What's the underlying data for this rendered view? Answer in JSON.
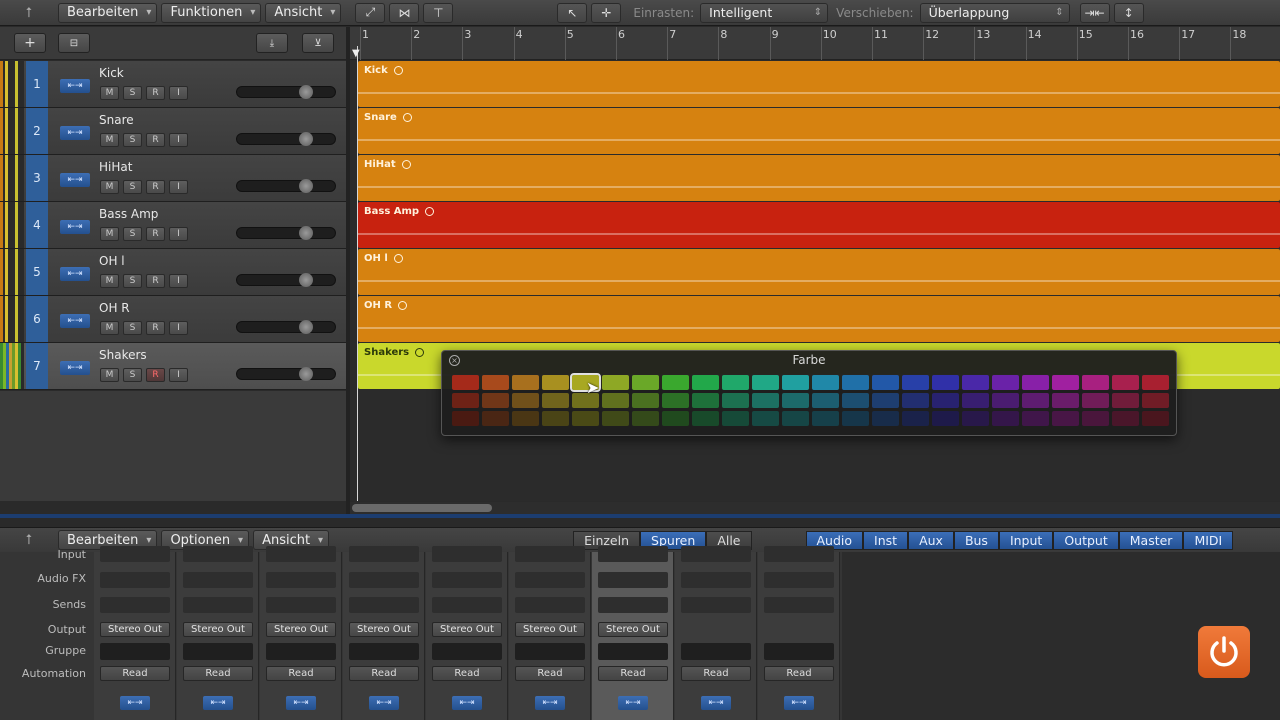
{
  "toolbar": {
    "menus": [
      "Bearbeiten",
      "Funktionen",
      "Ansicht"
    ],
    "snap_label": "Einrasten:",
    "snap_value": "Intelligent",
    "move_label": "Verschieben:",
    "move_value": "Überlappung"
  },
  "ruler": {
    "bars": [
      "1",
      "2",
      "3",
      "4",
      "5",
      "6",
      "7",
      "8",
      "9",
      "10",
      "11",
      "12",
      "13",
      "14",
      "15",
      "16",
      "17",
      "18"
    ]
  },
  "tracks": [
    {
      "num": "1",
      "name": "Kick",
      "color": "#c77a14",
      "region_color": "#d68210"
    },
    {
      "num": "2",
      "name": "Snare",
      "color": "#c77a14",
      "region_color": "#d68210"
    },
    {
      "num": "3",
      "name": "HiHat",
      "color": "#c77a14",
      "region_color": "#d68210"
    },
    {
      "num": "4",
      "name": "Bass Amp",
      "color": "#c77a14",
      "region_color": "#c8220f"
    },
    {
      "num": "5",
      "name": "OH l",
      "color": "#c77a14",
      "region_color": "#d68210"
    },
    {
      "num": "6",
      "name": "OH R",
      "color": "#c77a14",
      "region_color": "#d68210"
    },
    {
      "num": "7",
      "name": "Shakers",
      "color": "#6a9a2a",
      "region_color": "#c9d82c"
    }
  ],
  "track_buttons": [
    "M",
    "S",
    "R",
    "I"
  ],
  "color_picker": {
    "title": "Farbe",
    "row1": [
      "#a52a1a",
      "#a84a1c",
      "#a8701e",
      "#a89020",
      "#a8a822",
      "#8ea825",
      "#6aa828",
      "#3aa82e",
      "#22a84a",
      "#20a86a",
      "#20a886",
      "#20a0a0",
      "#2088a8",
      "#2070a8",
      "#2258a8",
      "#2840a8",
      "#3030a8",
      "#4a28a8",
      "#6a22a8",
      "#8820a8",
      "#a020a0",
      "#a82080",
      "#a8204e",
      "#a82030"
    ],
    "row2": [
      "#6e2216",
      "#703618",
      "#70501a",
      "#70641c",
      "#70701c",
      "#60701e",
      "#4a7020",
      "#2c7026",
      "#1e703a",
      "#1c7050",
      "#1c7062",
      "#1c6a6a",
      "#1c5e70",
      "#1c4e70",
      "#1e3e70",
      "#222e70",
      "#282270",
      "#381e70",
      "#4a1c70",
      "#5e1c70",
      "#6a1c6a",
      "#701c58",
      "#701c3a",
      "#701c26"
    ],
    "row3": [
      "#4a1a12",
      "#4a2614",
      "#4a3614",
      "#4a4416",
      "#4a4a16",
      "#404a18",
      "#344a1a",
      "#204a1e",
      "#184a2a",
      "#164a38",
      "#164a44",
      "#164646",
      "#16404a",
      "#16364a",
      "#182c4a",
      "#1a224a",
      "#1e1a4a",
      "#28184a",
      "#34164a",
      "#40164a",
      "#481646",
      "#4a163c",
      "#4a162a",
      "#4a161e"
    ],
    "selected_index": 4
  },
  "mixer_bar": {
    "menus": [
      "Bearbeiten",
      "Optionen",
      "Ansicht"
    ],
    "view_tabs": [
      "Einzeln",
      "Spuren",
      "Alle"
    ],
    "active_view": "Spuren",
    "filters": [
      "Audio",
      "Inst",
      "Aux",
      "Bus",
      "Input",
      "Output",
      "Master",
      "MIDI"
    ]
  },
  "mixer": {
    "labels": [
      "Input",
      "Audio FX",
      "Sends",
      "Output",
      "Gruppe",
      "Automation"
    ],
    "strips": [
      {
        "output": "Stereo Out",
        "automation": "Read"
      },
      {
        "output": "Stereo Out",
        "automation": "Read"
      },
      {
        "output": "Stereo Out",
        "automation": "Read"
      },
      {
        "output": "Stereo Out",
        "automation": "Read"
      },
      {
        "output": "Stereo Out",
        "automation": "Read"
      },
      {
        "output": "Stereo Out",
        "automation": "Read"
      },
      {
        "output": "Stereo Out",
        "automation": "Read"
      },
      {
        "output": "",
        "automation": "Read"
      },
      {
        "output": "",
        "automation": "Read"
      }
    ]
  }
}
